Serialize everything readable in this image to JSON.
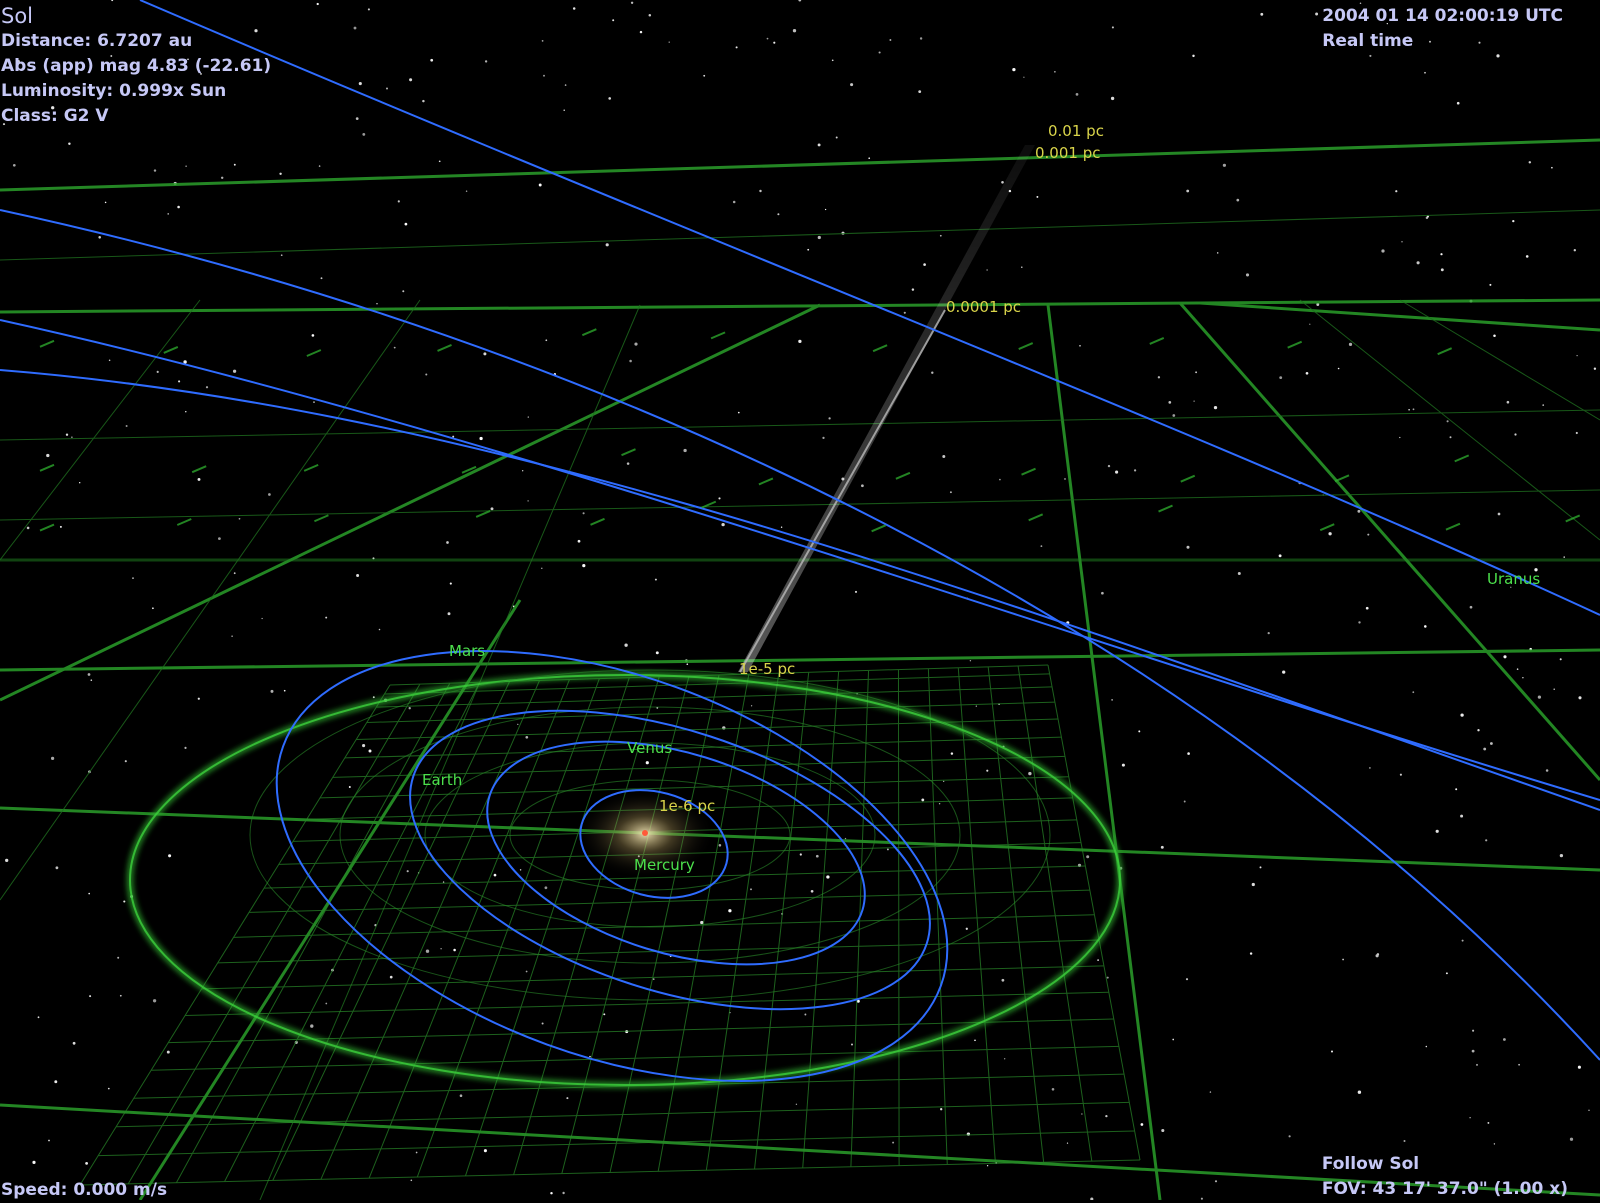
{
  "object": {
    "name": "Sol",
    "distance": "Distance: 6.7207 au",
    "magnitude": "Abs (app) mag  4.83 (-22.61)",
    "luminosity": "Luminosity: 0.999x Sun",
    "class": "Class: G2 V"
  },
  "time": {
    "datetime": "2004 01 14 02:00:19 UTC",
    "mode": "Real time"
  },
  "status": {
    "follow": "Follow Sol",
    "fov": "FOV: 43 17' 37.0\" (1.00 x)",
    "speed": "Speed: 0.000 m/s"
  },
  "planets": {
    "mercury": "Mercury",
    "venus": "Venus",
    "earth": "Earth",
    "mars": "Mars",
    "uranus": "Uranus"
  },
  "scale_markers": {
    "m1": "1e-6 pc",
    "m2": "1e-5 pc",
    "m3": "0.0001 pc",
    "m4": "0.001 pc",
    "m5": "0.01 pc"
  },
  "colors": {
    "hud_text": "#c6c8f6",
    "orbit": "#2f6cff",
    "grid": "#2fb02f",
    "planet_label": "#4ce04c",
    "scale_label": "#d9d44a"
  }
}
